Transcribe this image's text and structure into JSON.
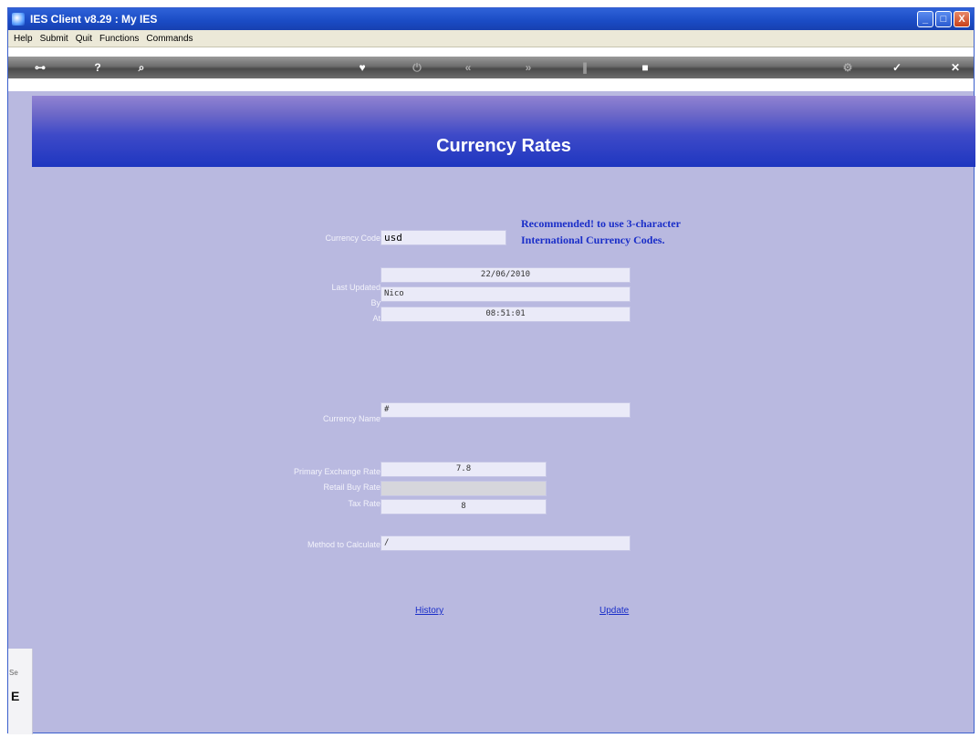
{
  "window": {
    "title": "IES Client v8.29 : My IES"
  },
  "window_buttons": [
    "_",
    "□",
    "X"
  ],
  "menu": [
    "Help",
    "Submit",
    "Quit",
    "Functions",
    "Commands"
  ],
  "header": {
    "title": "Currency Rates"
  },
  "notice": {
    "line1": "Recommended! to use 3-character",
    "line2": "International Currency Codes."
  },
  "form": {
    "currency_code_label": "Currency Code",
    "currency_code_value": "usd",
    "last_updated_label": "Last Updated",
    "last_updated_value": "22/06/2010",
    "by_label": "By",
    "by_value": "Nico",
    "at_label": "At",
    "at_value": "08:51:01",
    "currency_name_label": "Currency Name",
    "currency_name_value": "#",
    "primary_rate_label": "Primary Exchange Rate",
    "primary_rate_value": "7.8",
    "retail_buy_label": "Retail Buy Rate",
    "retail_buy_value": "",
    "tax_rate_label": "Tax Rate",
    "tax_rate_value": "8",
    "method_label": "Method to Calculate",
    "method_value": "/"
  },
  "links": {
    "history": "History",
    "update": "Update"
  },
  "side_panel": {
    "text1": "Se",
    "text2": "E"
  },
  "colors": {
    "accent": "#1a2ec8",
    "banner_top": "#9183d2",
    "banner_bottom": "#1e36c0",
    "panel_bg": "#b9b9e0"
  }
}
